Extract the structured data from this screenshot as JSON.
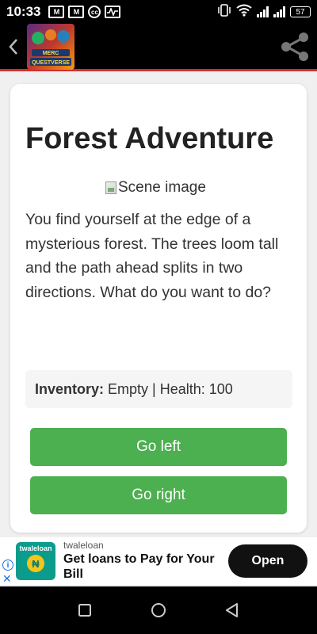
{
  "status_bar": {
    "time": "10:33",
    "battery": "57"
  },
  "header": {
    "logo_alt": "Merc Questverse"
  },
  "card": {
    "title": "Forest Adventure",
    "scene_image_alt": "Scene image",
    "story": "You find yourself at the edge of a mysterious forest. The trees loom tall and the path ahead splits in two directions. What do you want to do?",
    "stats_label": "Inventory:",
    "stats_value": "Empty | Health: 100",
    "choices": [
      {
        "label": "Go left"
      },
      {
        "label": "Go right"
      }
    ]
  },
  "ad": {
    "logo_text": "twaleloan",
    "coin_symbol": "₦",
    "brand": "twaleloan",
    "headline": "Get loans to Pay for Your Bill",
    "cta": "Open"
  },
  "colors": {
    "accent_button": "#4caf50",
    "header_underline": "#d32f2f",
    "ad_logo": "#0b9c8c"
  }
}
